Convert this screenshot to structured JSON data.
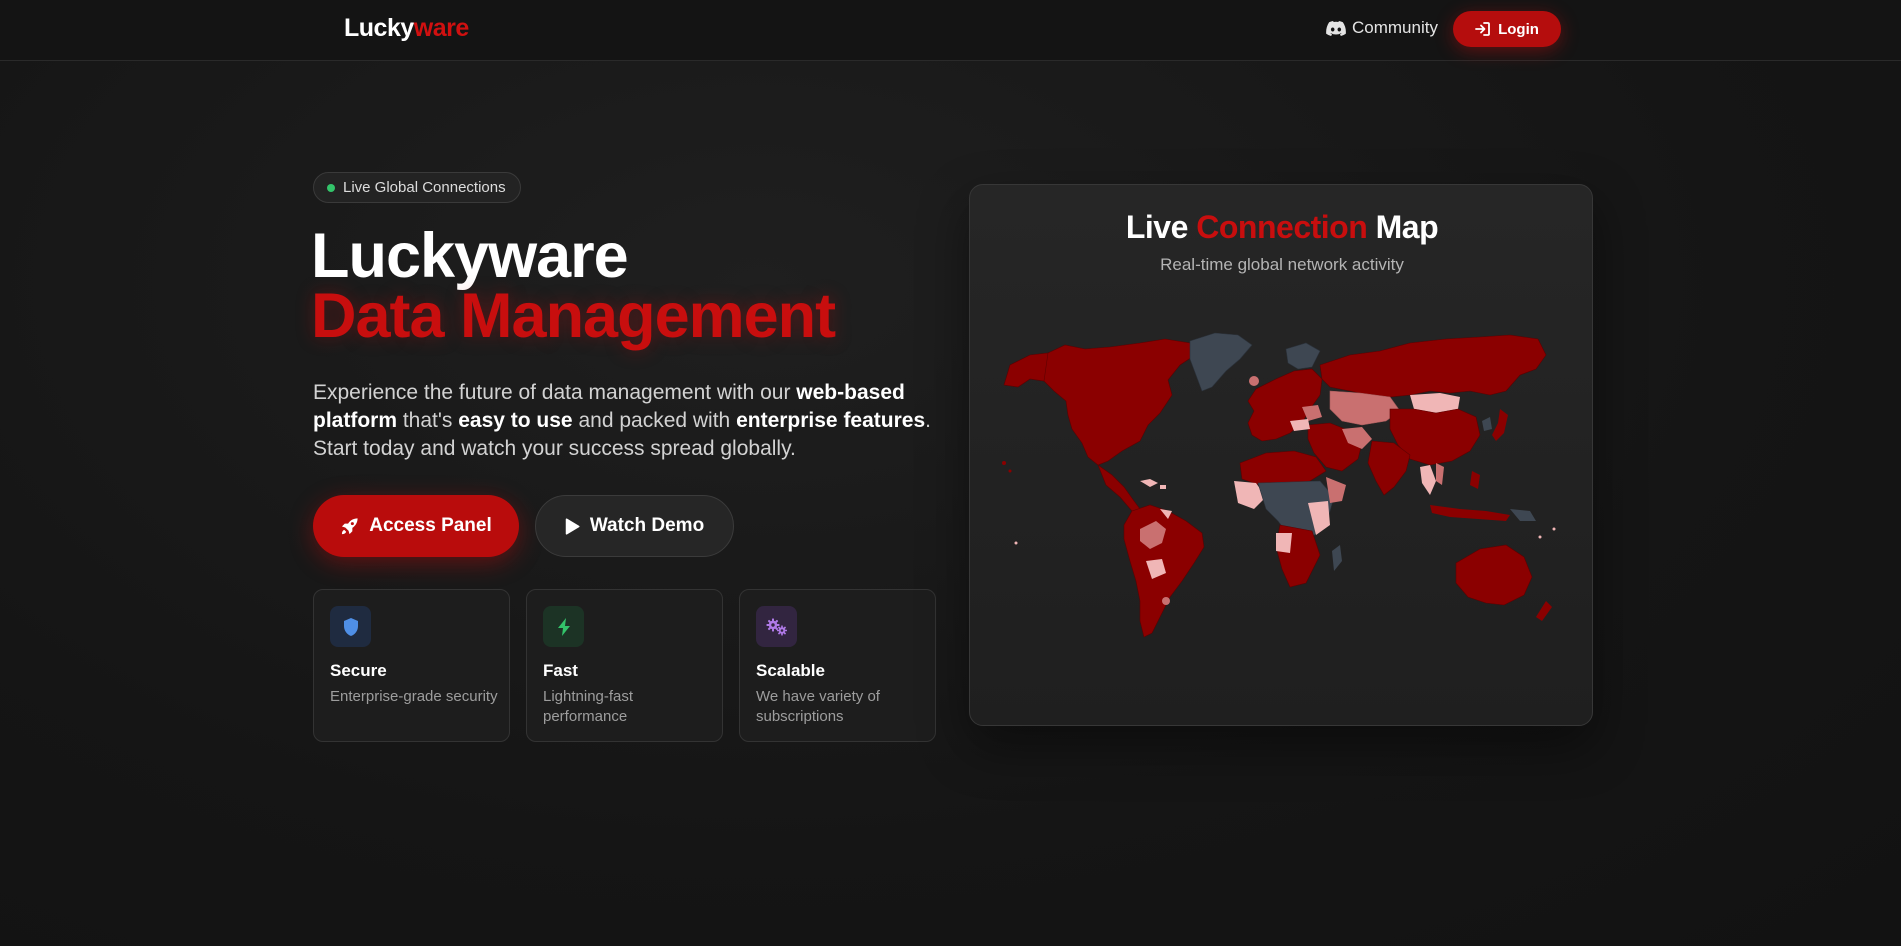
{
  "nav": {
    "logo_main": "Lucky",
    "logo_accent": "ware",
    "community_label": "Community",
    "login_label": "Login"
  },
  "hero": {
    "badge_label": "Live Global Connections",
    "title_line1": "Luckyware",
    "title_line2": "Data Management",
    "desc_part1": "Experience the future of data management with our ",
    "desc_bold1": "web-based platform",
    "desc_part2": " that's ",
    "desc_bold2": "easy to use",
    "desc_part3": " and packed with ",
    "desc_bold3": "enterprise features",
    "desc_part4": ". Start today and watch your success spread globally.",
    "primary_button": "Access Panel",
    "secondary_button": "Watch Demo"
  },
  "features": [
    {
      "title": "Secure",
      "desc": "Enterprise-grade security",
      "icon": "shield-icon",
      "color": "#4f8fe6"
    },
    {
      "title": "Fast",
      "desc": "Lightning-fast performance",
      "icon": "bolt-icon",
      "color": "#33c46a"
    },
    {
      "title": "Scalable",
      "desc": "We have variety of subscriptions",
      "icon": "gears-icon",
      "color": "#b07ae8"
    }
  ],
  "map": {
    "title_part1": "Live ",
    "title_accent": "Connection",
    "title_part2": " Map",
    "subtitle": "Real-time global network activity",
    "colors": {
      "high": "#8b0000",
      "medium": "#c97070",
      "low": "#f0b6b6",
      "none": "#3e4752"
    }
  },
  "theme": {
    "accent": "#c80e0e",
    "background": "#151515",
    "status_green": "#33c46a"
  }
}
